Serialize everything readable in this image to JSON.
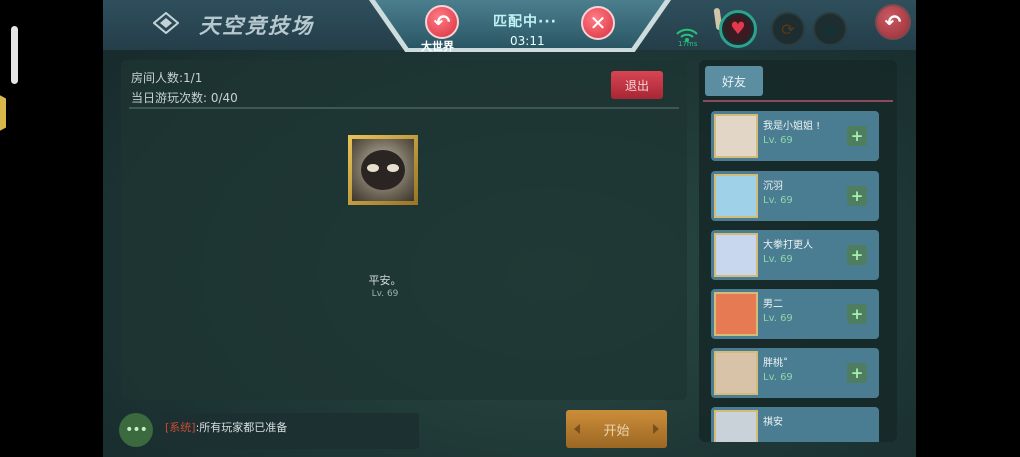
{
  "header": {
    "title": "天空竞技场",
    "world_label": "大世界",
    "match_status": "匹配中···",
    "match_timer": "03:11",
    "signal_label": "17ms"
  },
  "room": {
    "player_count": "房间人数:1/1",
    "daily_plays": "当日游玩次数: 0/40",
    "leave_label": "退出",
    "player": {
      "name": "平安。",
      "level": "Lv. 69"
    }
  },
  "chat": {
    "tag": "[系统]",
    "message": ":所有玩家都已准备",
    "button_glyph": "•••"
  },
  "start_label": "开始",
  "friends": {
    "tab_label": "好友",
    "items": [
      {
        "name": "我是小姐姐 !",
        "level": "Lv. 69",
        "avatar_color": "#e2d6c6"
      },
      {
        "name": "沉羽",
        "level": "Lv. 69",
        "avatar_color": "#9fd2e8"
      },
      {
        "name": "大拳打更人",
        "level": "Lv. 69",
        "avatar_color": "#c9d7ee"
      },
      {
        "name": "男二",
        "level": "Lv. 69",
        "avatar_color": "#e67a52"
      },
      {
        "name": "胖桃˚",
        "level": "Lv. 69",
        "avatar_color": "#d8c2a8"
      },
      {
        "name": "祺安",
        "level": "",
        "avatar_color": "#c9d2d8"
      }
    ]
  },
  "colors": {
    "accent_red": "#d8303e",
    "panel_teal": "#4a7d92",
    "start_orange": "#cc8d39",
    "heart_red": "#e23a4c"
  }
}
